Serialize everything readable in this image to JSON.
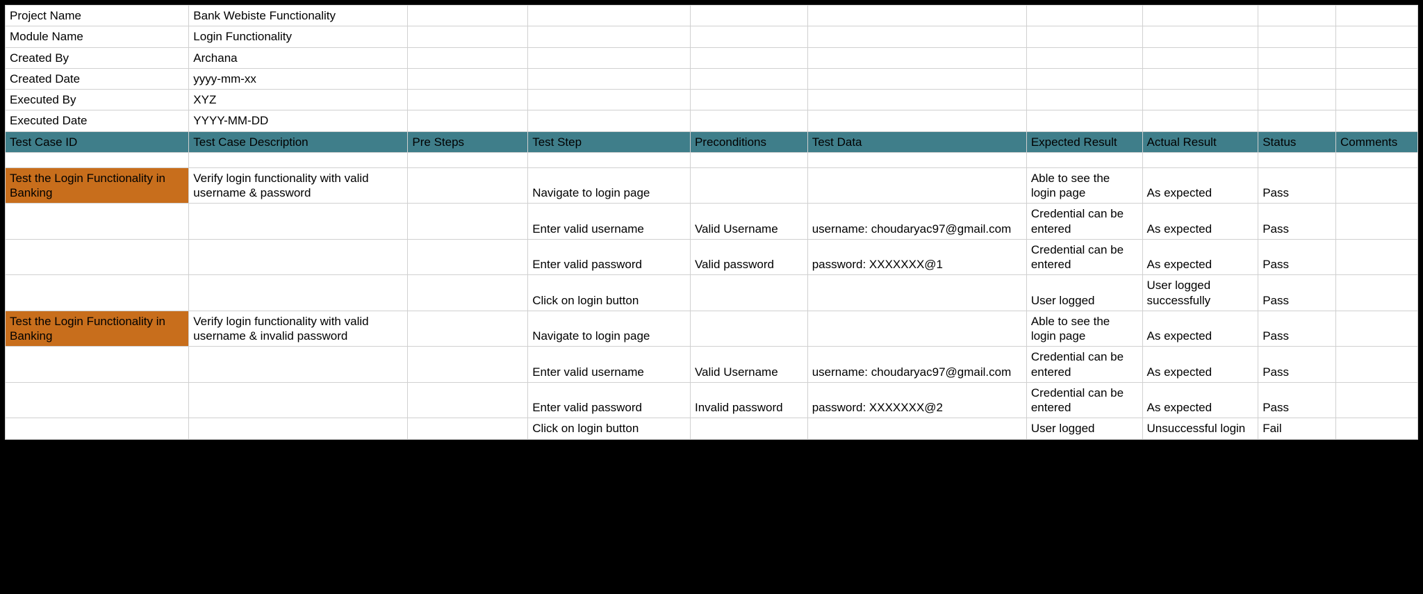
{
  "meta_rows": [
    {
      "label": "Project Name",
      "value": "Bank Webiste Functionality"
    },
    {
      "label": "Module Name",
      "value": "Login Functionality"
    },
    {
      "label": "Created By",
      "value": "Archana"
    },
    {
      "label": "Created Date",
      "value": "yyyy-mm-xx"
    },
    {
      "label": "Executed By",
      "value": "XYZ"
    },
    {
      "label": "Executed Date",
      "value": "YYYY-MM-DD"
    }
  ],
  "headers": [
    "Test Case ID",
    "Test Case Description",
    "Pre Steps",
    "Test Step",
    "Preconditions",
    "Test Data",
    "Expected Result",
    "Actual Result",
    "Status",
    "Comments"
  ],
  "rows": [
    {
      "id": "Test the Login Functionality in Banking",
      "id_orange": true,
      "desc": "Verify login functionality with valid username & password",
      "pre": "",
      "step": "Navigate to login page",
      "precond": "",
      "data": "",
      "expected": "Able to see the login page",
      "actual": "As expected",
      "status": "Pass",
      "comments": ""
    },
    {
      "id": "",
      "id_orange": false,
      "desc": "",
      "pre": "",
      "step": "Enter valid username",
      "precond": "Valid Username",
      "data": "username: choudaryac97@gmail.com",
      "expected": "Credential can be entered",
      "actual": "As expected",
      "status": "Pass",
      "comments": ""
    },
    {
      "id": "",
      "id_orange": false,
      "desc": "",
      "pre": "",
      "step": "Enter valid password",
      "precond": "Valid password",
      "data": "password: XXXXXXX@1",
      "expected": "Credential can be entered",
      "actual": "As expected",
      "status": "Pass",
      "comments": ""
    },
    {
      "id": "",
      "id_orange": false,
      "desc": "",
      "pre": "",
      "step": "Click on login button",
      "precond": "",
      "data": "",
      "expected": "User logged",
      "actual": "User logged successfully",
      "status": "Pass",
      "comments": ""
    },
    {
      "id": "Test the Login Functionality in Banking",
      "id_orange": true,
      "desc": "Verify login functionality with valid username & invalid password",
      "pre": "",
      "step": "Navigate to login page",
      "precond": "",
      "data": "",
      "expected": "Able to see the login page",
      "actual": "As expected",
      "status": "Pass",
      "comments": ""
    },
    {
      "id": "",
      "id_orange": false,
      "desc": "",
      "pre": "",
      "step": "Enter valid username",
      "precond": "Valid Username",
      "data": "username: choudaryac97@gmail.com",
      "expected": "Credential can be entered",
      "actual": "As expected",
      "status": "Pass",
      "comments": ""
    },
    {
      "id": "",
      "id_orange": false,
      "desc": "",
      "pre": "",
      "step": "Enter valid password",
      "precond": "Invalid password",
      "data": "password: XXXXXXX@2",
      "expected": "Credential can be entered",
      "actual": "As expected",
      "status": "Pass",
      "comments": ""
    },
    {
      "id": "",
      "id_orange": false,
      "desc": "",
      "pre": "",
      "step": "Click on login button",
      "precond": "",
      "data": "",
      "expected": "User logged",
      "actual": "Unsuccessful login",
      "status": "Fail",
      "comments": ""
    }
  ]
}
